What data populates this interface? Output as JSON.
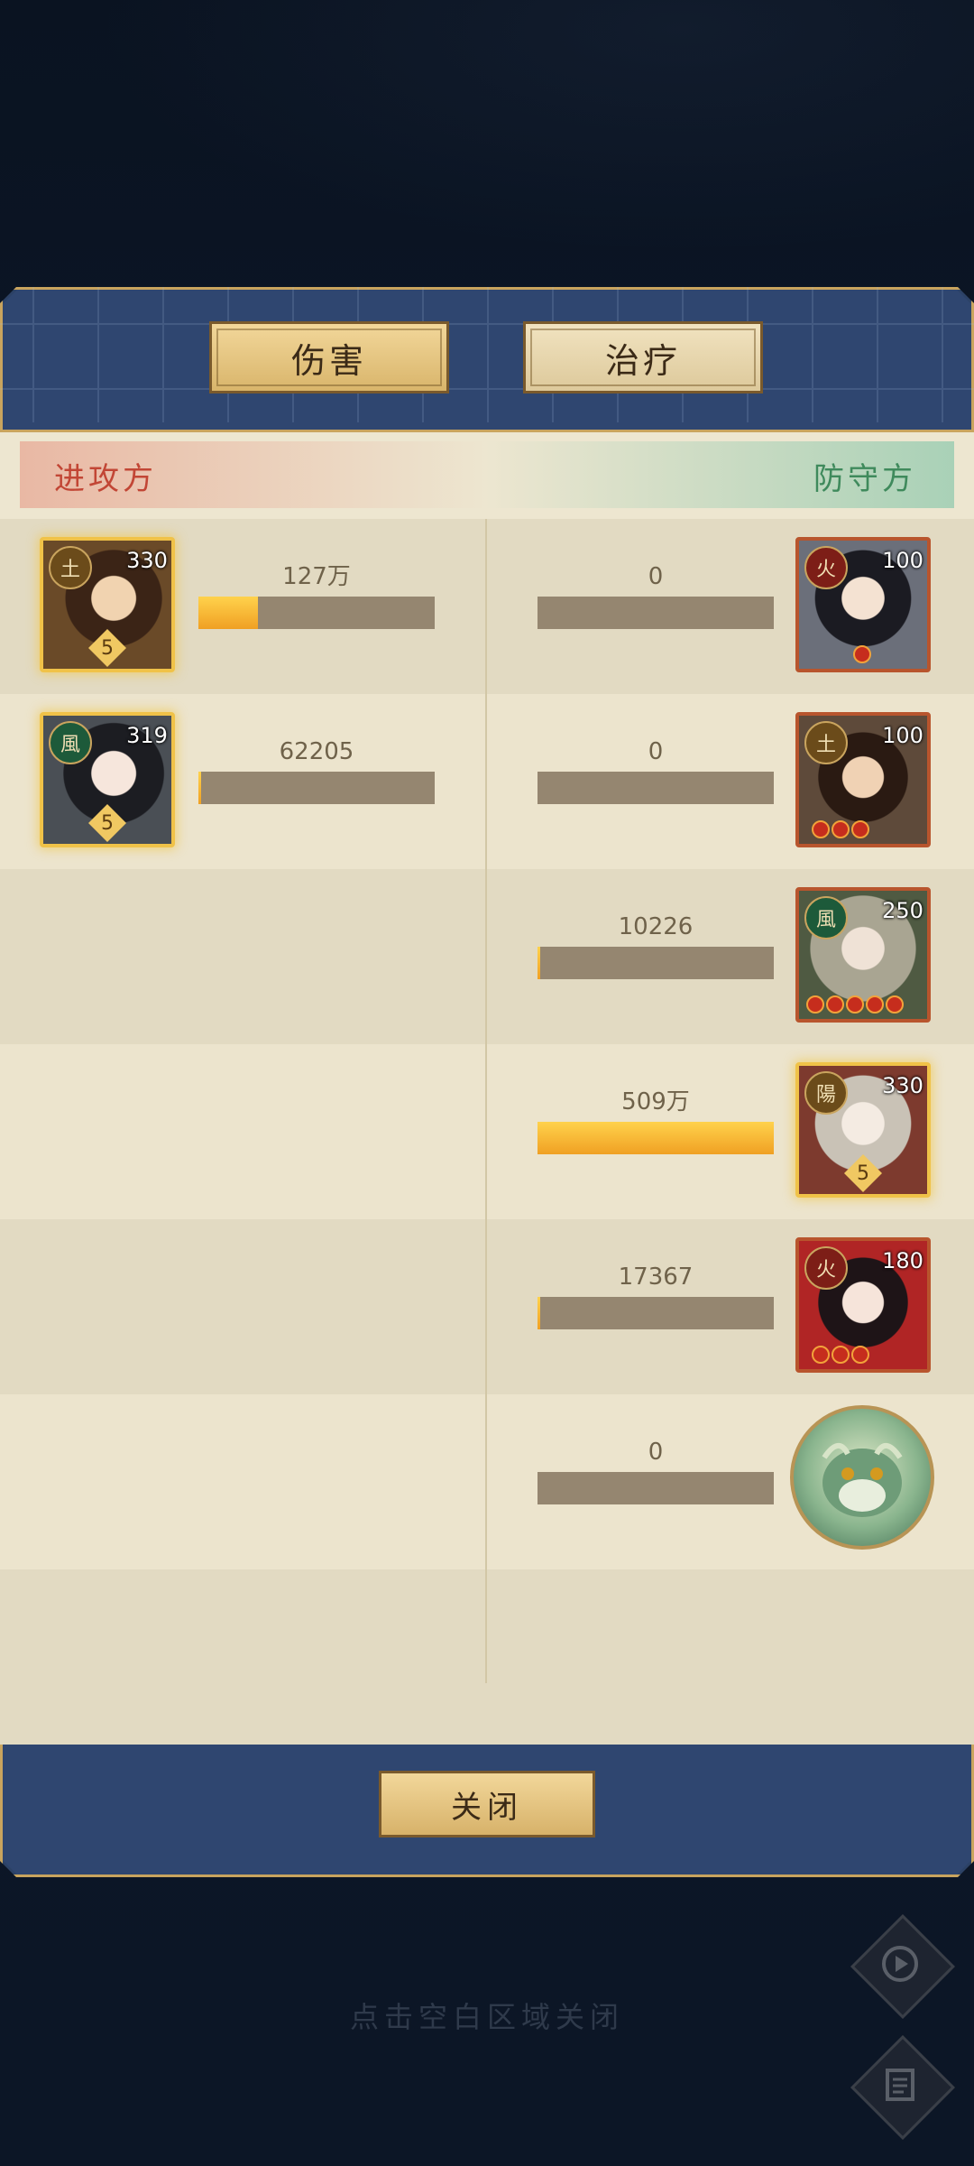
{
  "tabs": {
    "damage": "伤害",
    "heal": "治疗"
  },
  "sides": {
    "attack": "进攻方",
    "defend": "防守方"
  },
  "rows": [
    {
      "left": {
        "faction": "土",
        "level": "330",
        "stars": "5",
        "value": "127万",
        "fill": 0.25
      },
      "right": {
        "faction": "火",
        "level": "100",
        "orbs": 1,
        "value": "0",
        "fill": 0
      }
    },
    {
      "left": {
        "faction": "風",
        "level": "319",
        "stars": "5",
        "value": "62205",
        "fill": 0.012
      },
      "right": {
        "faction": "土",
        "level": "100",
        "orbs": 3,
        "value": "0",
        "fill": 0
      }
    },
    {
      "right": {
        "faction": "風",
        "level": "250",
        "orbs": 5,
        "value": "10226",
        "fill": 0.01
      }
    },
    {
      "right": {
        "faction": "陽",
        "level": "330",
        "stars": "5",
        "value": "509万",
        "fill": 1.0
      }
    },
    {
      "right": {
        "faction": "火",
        "level": "180",
        "orbs": 3,
        "value": "17367",
        "fill": 0.01
      }
    },
    {
      "right": {
        "value": "0",
        "fill": 0,
        "icon": "dragon-icon"
      }
    }
  ],
  "close_button": "关闭",
  "hint": "点击空白区域关闭",
  "side_buttons": {
    "replay": "replay-icon",
    "log": "scroll-icon"
  },
  "colors": {
    "attack": "#c24635",
    "defend": "#3f8a5c",
    "bar_fill": "#f0a023",
    "bar_empty": "#958670"
  }
}
